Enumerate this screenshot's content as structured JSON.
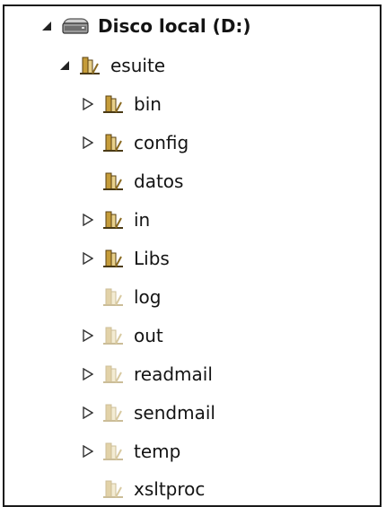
{
  "tree": {
    "root": {
      "label": "Disco local (D:)",
      "expanded": true,
      "icon": "drive-icon"
    },
    "child": {
      "label": "esuite",
      "expanded": true,
      "icon": "folder-icon"
    },
    "items": [
      {
        "label": "bin",
        "expander": "collapsed",
        "icon": "folder-icon",
        "faded": false
      },
      {
        "label": "config",
        "expander": "collapsed",
        "icon": "folder-icon",
        "faded": false
      },
      {
        "label": "datos",
        "expander": "none",
        "icon": "folder-icon",
        "faded": false
      },
      {
        "label": "in",
        "expander": "collapsed",
        "icon": "folder-icon",
        "faded": false
      },
      {
        "label": "Libs",
        "expander": "collapsed",
        "icon": "folder-icon",
        "faded": false
      },
      {
        "label": "log",
        "expander": "none",
        "icon": "folder-icon",
        "faded": true
      },
      {
        "label": "out",
        "expander": "collapsed",
        "icon": "folder-icon",
        "faded": true
      },
      {
        "label": "readmail",
        "expander": "collapsed",
        "icon": "folder-icon",
        "faded": true
      },
      {
        "label": "sendmail",
        "expander": "collapsed",
        "icon": "folder-icon",
        "faded": true
      },
      {
        "label": "temp",
        "expander": "collapsed",
        "icon": "folder-icon",
        "faded": true
      },
      {
        "label": "xsltproc",
        "expander": "none",
        "icon": "folder-icon",
        "faded": true
      }
    ]
  }
}
